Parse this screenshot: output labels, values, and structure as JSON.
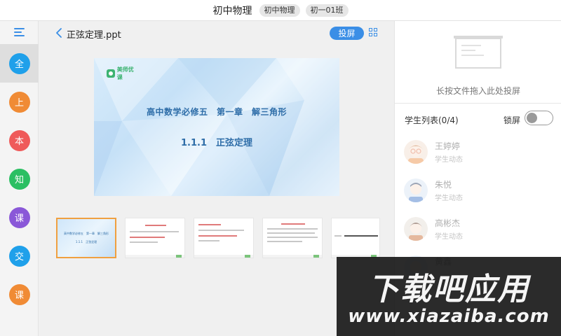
{
  "topbar": {
    "title": "初中物理",
    "chips": [
      "初中物理",
      "初一01班"
    ]
  },
  "sidebar": {
    "items": [
      {
        "label": "全",
        "color": "#1fa0ea"
      },
      {
        "label": "上",
        "color": "#f08b35"
      },
      {
        "label": "本",
        "color": "#ef5a5a"
      },
      {
        "label": "知",
        "color": "#2bbf63"
      },
      {
        "label": "课",
        "color": "#8a58d8"
      },
      {
        "label": "交",
        "color": "#1fa0ea"
      },
      {
        "label": "课",
        "color": "#f08b35"
      }
    ]
  },
  "main": {
    "file_title": "正弦定理.ppt",
    "project_label": "投屏",
    "slide": {
      "logo_text": "美师优课",
      "line1": "高中数学必修五　第一章　解三角形",
      "line2": "1.1.1　正弦定理"
    },
    "thumbnails": [
      {
        "line1": "高中数学必修五　第一章　解三角形",
        "line2": "1.1.1　正弦定理"
      }
    ]
  },
  "right": {
    "drop_text": "长按文件拖入此处投屏",
    "list_header": "学生列表(0/4)",
    "lock_label": "锁屏",
    "students": [
      {
        "name": "王婷婷",
        "status": "学生动态"
      },
      {
        "name": "朱悦",
        "status": "学生动态"
      },
      {
        "name": "高彬杰",
        "status": "学生动态"
      },
      {
        "name": "黄鑫",
        "status": ""
      }
    ]
  },
  "watermark": {
    "big": "下载吧应用",
    "small": "www.xiazaiba.com"
  },
  "colors": {
    "accent": "#3a8ee6",
    "selected_thumb_border": "#f0a040"
  }
}
